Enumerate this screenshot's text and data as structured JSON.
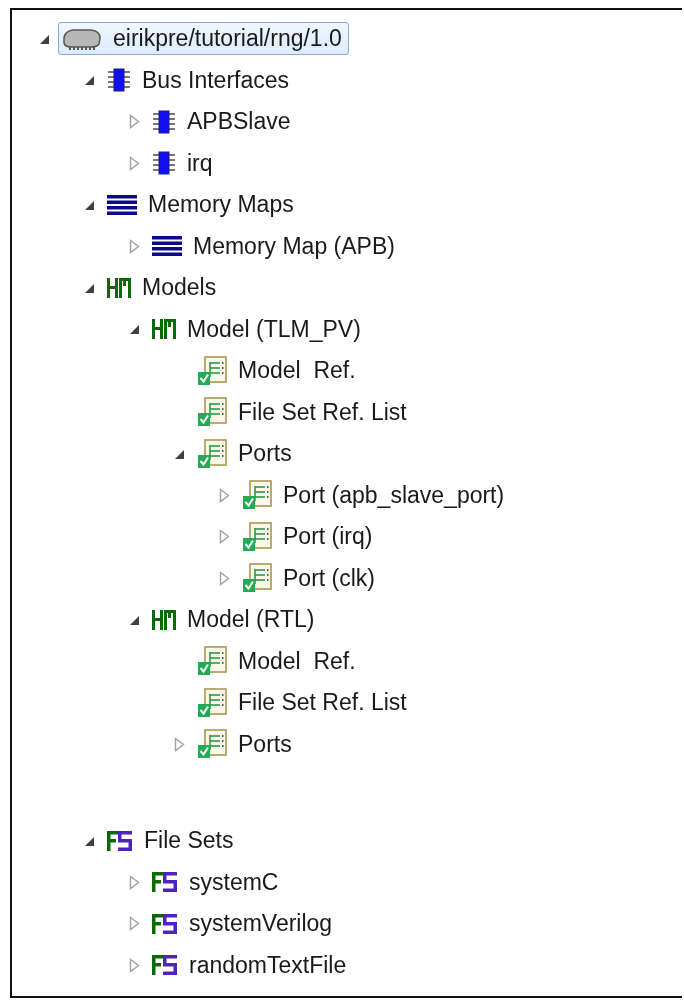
{
  "tree": [
    {
      "label": "eirikpre/tutorial/rng/1.0",
      "kind": "chip",
      "expanded": true,
      "selected": true,
      "children": [
        {
          "label": "Bus Interfaces",
          "kind": "bus",
          "expanded": true,
          "selected": false,
          "children": [
            {
              "label": "APBSlave",
              "kind": "bus",
              "expanded": false,
              "selected": false
            },
            {
              "label": "irq",
              "kind": "bus",
              "expanded": false,
              "selected": false
            }
          ]
        },
        {
          "label": "Memory Maps",
          "kind": "memory",
          "expanded": true,
          "selected": false,
          "children": [
            {
              "label": "Memory Map (APB)",
              "kind": "memory",
              "expanded": false,
              "selected": false
            }
          ]
        },
        {
          "label": "Models",
          "kind": "model",
          "expanded": true,
          "selected": false,
          "children": [
            {
              "label": "Model (TLM_PV)",
              "kind": "model",
              "expanded": true,
              "selected": false,
              "children": [
                {
                  "label": "Model  Ref.",
                  "kind": "element",
                  "selected": false
                },
                {
                  "label": "File Set Ref. List",
                  "kind": "element",
                  "selected": false
                },
                {
                  "label": "Ports",
                  "kind": "element",
                  "expanded": true,
                  "selected": false,
                  "children": [
                    {
                      "label": "Port (apb_slave_port)",
                      "kind": "element",
                      "expanded": false,
                      "selected": false
                    },
                    {
                      "label": "Port (irq)",
                      "kind": "element",
                      "expanded": false,
                      "selected": false
                    },
                    {
                      "label": "Port (clk)",
                      "kind": "element",
                      "expanded": false,
                      "selected": false
                    }
                  ]
                }
              ]
            },
            {
              "label": "Model (RTL)",
              "kind": "model",
              "expanded": true,
              "selected": false,
              "children": [
                {
                  "label": "Model  Ref.",
                  "kind": "element",
                  "selected": false
                },
                {
                  "label": "File Set Ref. List",
                  "kind": "element",
                  "selected": false
                },
                {
                  "label": "Ports",
                  "kind": "element",
                  "expanded": false,
                  "selected": false
                }
              ]
            }
          ]
        },
        {
          "label": "File Sets",
          "kind": "fileset",
          "expanded": true,
          "selected": false,
          "children": [
            {
              "label": "systemC",
              "kind": "fileset",
              "expanded": false,
              "selected": false
            },
            {
              "label": "systemVerilog",
              "kind": "fileset",
              "expanded": false,
              "selected": false
            },
            {
              "label": "randomTextFile",
              "kind": "fileset",
              "expanded": false,
              "selected": false
            }
          ]
        }
      ]
    }
  ]
}
